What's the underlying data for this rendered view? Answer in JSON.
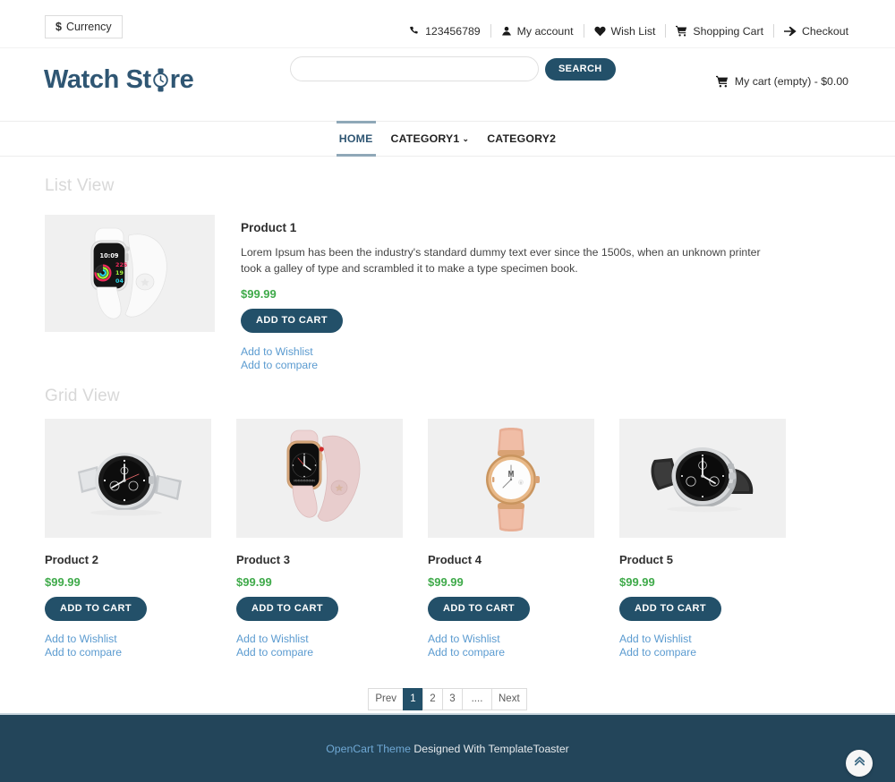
{
  "topbar": {
    "currency": {
      "symbol": "$",
      "label": "Currency"
    },
    "links": [
      {
        "name": "phone",
        "icon": "phone-icon",
        "label": "123456789"
      },
      {
        "name": "my-account",
        "icon": "user-icon",
        "label": "My account"
      },
      {
        "name": "wish-list",
        "icon": "heart-icon",
        "label": "Wish List"
      },
      {
        "name": "shopping-cart",
        "icon": "cart-icon",
        "label": "Shopping Cart"
      },
      {
        "name": "checkout",
        "icon": "arrow-right-icon",
        "label": "Checkout"
      }
    ]
  },
  "header": {
    "logo_before": "Watch St",
    "logo_after": "re",
    "logo_icon": "watch-icon",
    "search": {
      "value": "",
      "placeholder": "",
      "button_label": "SEARCH"
    },
    "mini_cart": {
      "icon": "cart-icon",
      "label": "My cart (empty) - $0.00"
    }
  },
  "nav": {
    "items": [
      {
        "label": "HOME",
        "active": true,
        "has_dropdown": false
      },
      {
        "label": "CATEGORY1",
        "active": false,
        "has_dropdown": true,
        "chevron": "⌄"
      },
      {
        "label": "CATEGORY2",
        "active": false,
        "has_dropdown": false
      }
    ]
  },
  "main": {
    "list_view": {
      "title": "List View",
      "product": {
        "name": "Product 1",
        "description": "Lorem Ipsum has been the industry's standard dummy text ever since the 1500s, when an unknown printer took a galley of type and scrambled it to make a type specimen book.",
        "price": "$99.99",
        "add_to_cart": "ADD TO CART",
        "wishlist": "Add to Wishlist",
        "compare": "Add to compare",
        "image": "white-apple-watch-image"
      }
    },
    "grid_view": {
      "title": "Grid View",
      "products": [
        {
          "name": "Product 2",
          "price": "$99.99",
          "add_to_cart": "ADD TO CART",
          "wishlist": "Add to Wishlist",
          "compare": "Add to compare",
          "image": "silver-chronograph-watch-image"
        },
        {
          "name": "Product 3",
          "price": "$99.99",
          "add_to_cart": "ADD TO CART",
          "wishlist": "Add to Wishlist",
          "compare": "Add to compare",
          "image": "pink-apple-watch-image"
        },
        {
          "name": "Product 4",
          "price": "$99.99",
          "add_to_cart": "ADD TO CART",
          "wishlist": "Add to Wishlist",
          "compare": "Add to compare",
          "image": "rose-gold-leather-watch-image"
        },
        {
          "name": "Product 5",
          "price": "$99.99",
          "add_to_cart": "ADD TO CART",
          "wishlist": "Add to Wishlist",
          "compare": "Add to compare",
          "image": "black-leather-chronograph-image"
        }
      ]
    },
    "pagination": {
      "prev": "Prev",
      "pages": [
        "1",
        "2",
        "3"
      ],
      "ellipsis": "....",
      "next": "Next",
      "current": "1"
    }
  },
  "footer": {
    "brand_link": "OpenCart Theme",
    "text": " Designed With TemplateToaster",
    "scroll_top_icon": "double-chevron-up-icon"
  },
  "colors": {
    "accent_dark": "#235069",
    "logo": "#2f5673",
    "price_green": "#3faa4a",
    "link_blue": "#5b9bd0",
    "footer_bg": "#23455a",
    "section_title": "#d8d8d8",
    "image_bg": "#f0f0f0"
  }
}
